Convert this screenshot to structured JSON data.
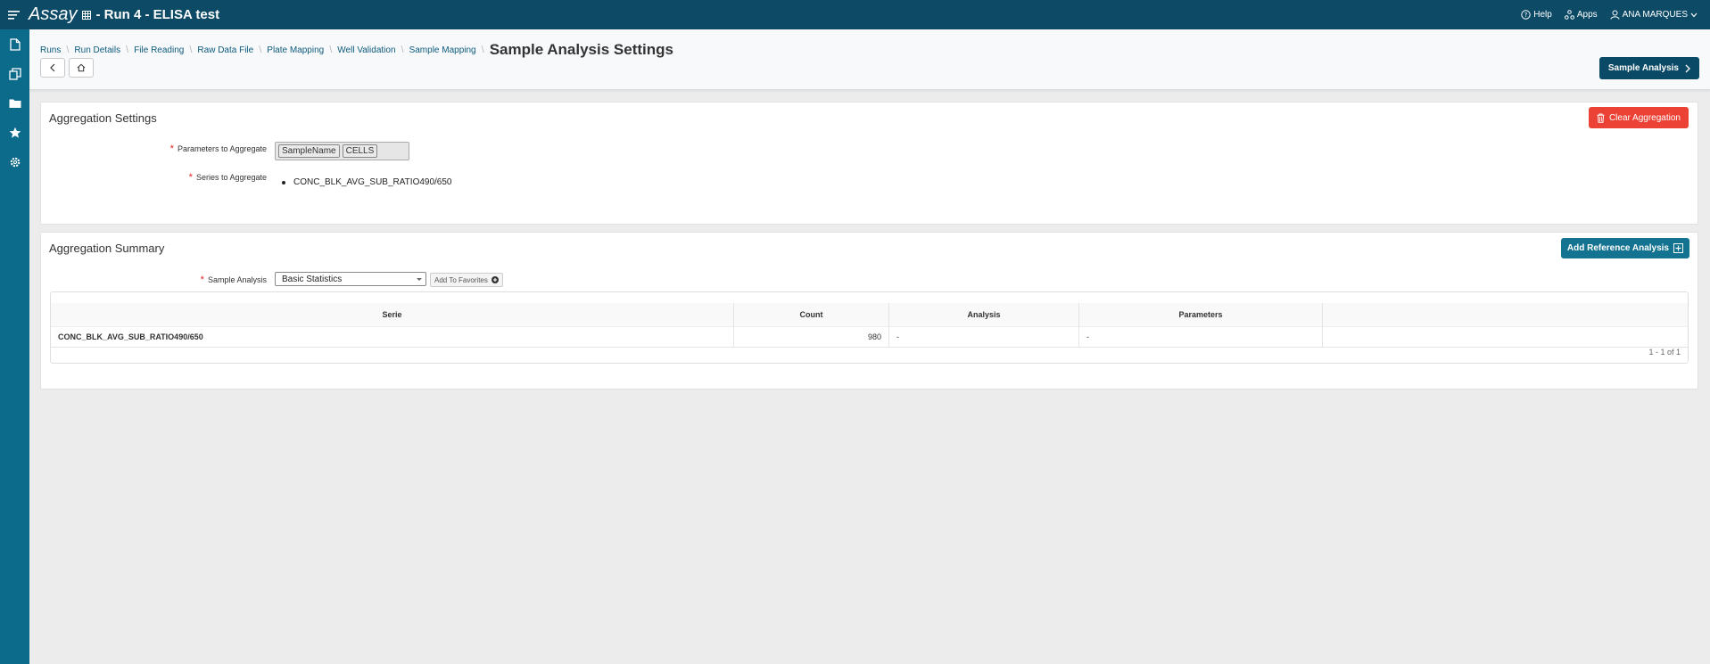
{
  "app": {
    "brand": "Assay",
    "run_title": "- Run 4 - ELISA test",
    "help_label": "Help",
    "apps_label": "Apps",
    "user_name": "ANA MARQUES"
  },
  "sidebar": {
    "items": [
      {
        "icon": "document-icon"
      },
      {
        "icon": "copy-icon"
      },
      {
        "icon": "folder-icon"
      },
      {
        "icon": "star-icon"
      },
      {
        "icon": "gear-icon"
      }
    ]
  },
  "breadcrumb": {
    "items": [
      "Runs",
      "Run Details",
      "File Reading",
      "Raw Data File",
      "Plate Mapping",
      "Well Validation",
      "Sample Mapping"
    ],
    "current": "Sample Analysis Settings"
  },
  "header": {
    "sample_analysis_button": "Sample Analysis"
  },
  "aggregation_settings": {
    "title": "Aggregation Settings",
    "clear_button": "Clear Aggregation",
    "params_label": "Parameters to Aggregate",
    "params_tags": [
      "SampleName",
      "CELLS"
    ],
    "series_label": "Series to Aggregate",
    "series": [
      "CONC_BLK_AVG_SUB_RATIO490/650"
    ]
  },
  "aggregation_summary": {
    "title": "Aggregation Summary",
    "add_reference_button": "Add Reference Analysis",
    "sample_analysis_label": "Sample Analysis",
    "sample_analysis_value": "Basic Statistics",
    "add_favorites_button": "Add To Favorites",
    "table": {
      "headers": [
        "Serie",
        "Count",
        "Analysis",
        "Parameters",
        ""
      ],
      "rows": [
        {
          "serie": "CONC_BLK_AVG_SUB_RATIO490/650",
          "count": "980",
          "analysis": "-",
          "parameters": "-"
        }
      ]
    },
    "pagination": "1 - 1 of 1"
  },
  "colors": {
    "topbar": "#0c4a66",
    "sidebar": "#0c6a8a",
    "danger": "#ec4236",
    "teal": "#137390",
    "link": "#0c5a7c"
  }
}
